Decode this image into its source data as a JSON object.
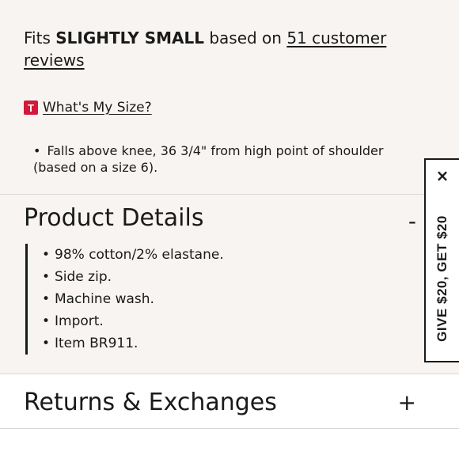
{
  "fit": {
    "prefix": "Fits ",
    "fit_value": "SLIGHTLY SMALL",
    "middle": " based on ",
    "reviews_link": "51 customer reviews"
  },
  "size_guide": {
    "badge": "T",
    "link": "What's My Size?"
  },
  "fit_note": "Falls above knee, 36 3/4\" from high point of shoulder (based on a size 6).",
  "product_details": {
    "title": "Product Details",
    "toggle": "-",
    "items": [
      "98% cotton/2% elastane.",
      "Side zip.",
      "Machine wash.",
      "Import.",
      "Item BR911."
    ]
  },
  "returns": {
    "title": "Returns & Exchanges",
    "toggle": "+"
  },
  "promo": {
    "label": "GIVE $20, GET $20",
    "close": "×"
  },
  "colors": {
    "panel_bg": "#f8f4f1",
    "badge_red": "#d0193b",
    "text": "#1a1a1a"
  }
}
